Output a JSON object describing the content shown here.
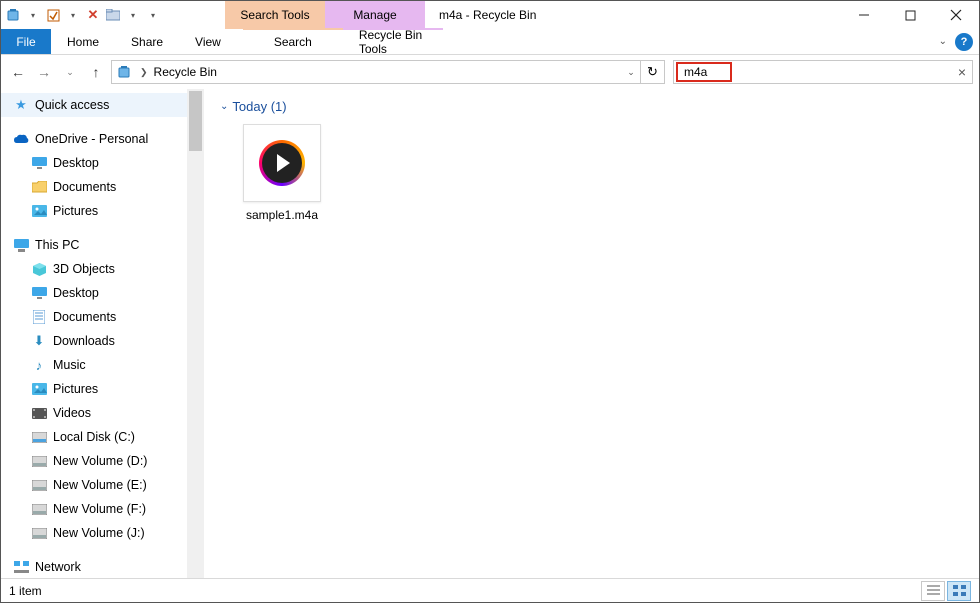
{
  "titlebar": {
    "ctx_search": "Search Tools",
    "ctx_manage": "Manage",
    "title": "m4a - Recycle Bin"
  },
  "ribbon": {
    "file": "File",
    "home": "Home",
    "share": "Share",
    "view": "View",
    "search_sub": "Search",
    "manage_sub": "Recycle Bin Tools"
  },
  "address": {
    "location": "Recycle Bin"
  },
  "search": {
    "value": "m4a"
  },
  "sidebar": {
    "quick": "Quick access",
    "onedrive": "OneDrive - Personal",
    "od_items": [
      "Desktop",
      "Documents",
      "Pictures"
    ],
    "thispc": "This PC",
    "pc_items": [
      "3D Objects",
      "Desktop",
      "Documents",
      "Downloads",
      "Music",
      "Pictures",
      "Videos",
      "Local Disk (C:)",
      "New Volume (D:)",
      "New Volume (E:)",
      "New Volume (F:)",
      "New Volume (J:)"
    ],
    "network": "Network"
  },
  "content": {
    "group": "Today (1)",
    "files": [
      "sample1.m4a"
    ]
  },
  "status": {
    "count": "1 item"
  }
}
